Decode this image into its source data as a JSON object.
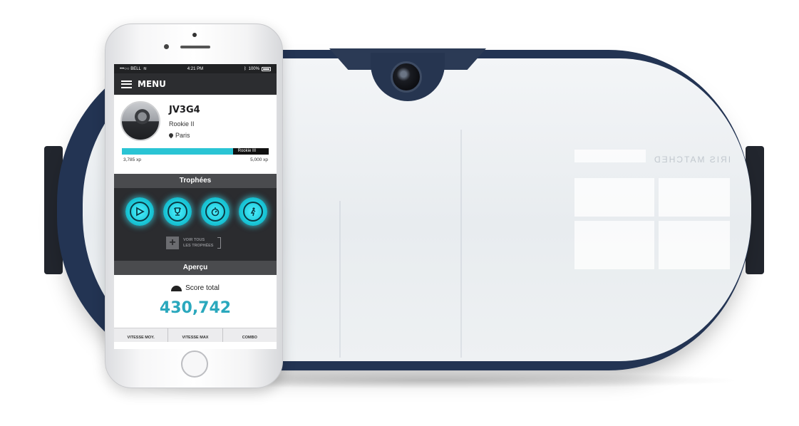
{
  "phone": {
    "status_bar": {
      "carrier": "•••○○ BELL",
      "time": "4:21 PM",
      "battery": "100%"
    },
    "app_bar": {
      "menu_label": "MENU"
    },
    "profile": {
      "username": "JV3G4",
      "rank": "Rookie II",
      "location": "Paris",
      "xp_current": "3,785 xp",
      "xp_target": "5,000 xp",
      "next_rank": "Rookie III",
      "xp_progress": 0.757
    },
    "trophies": {
      "title": "Trophées",
      "icons": [
        "play-icon",
        "trophy-icon",
        "stopwatch-icon",
        "runner-icon"
      ],
      "see_all_line1": "VOIR TOUS",
      "see_all_line2": "LES TROPHÉES"
    },
    "overview": {
      "title": "Aperçu",
      "score_label": "Score total",
      "score_value": "430,742",
      "stats": [
        "VITESSE MOY.",
        "VITESSE MAX",
        "COMBO"
      ]
    }
  },
  "headset": {
    "visor_text": "IRIS MATCHED"
  },
  "colors": {
    "accent": "#2ac4d4",
    "score": "#2aa8bd",
    "headset_shell": "#233453",
    "dark_panel": "#2b2c2f"
  }
}
